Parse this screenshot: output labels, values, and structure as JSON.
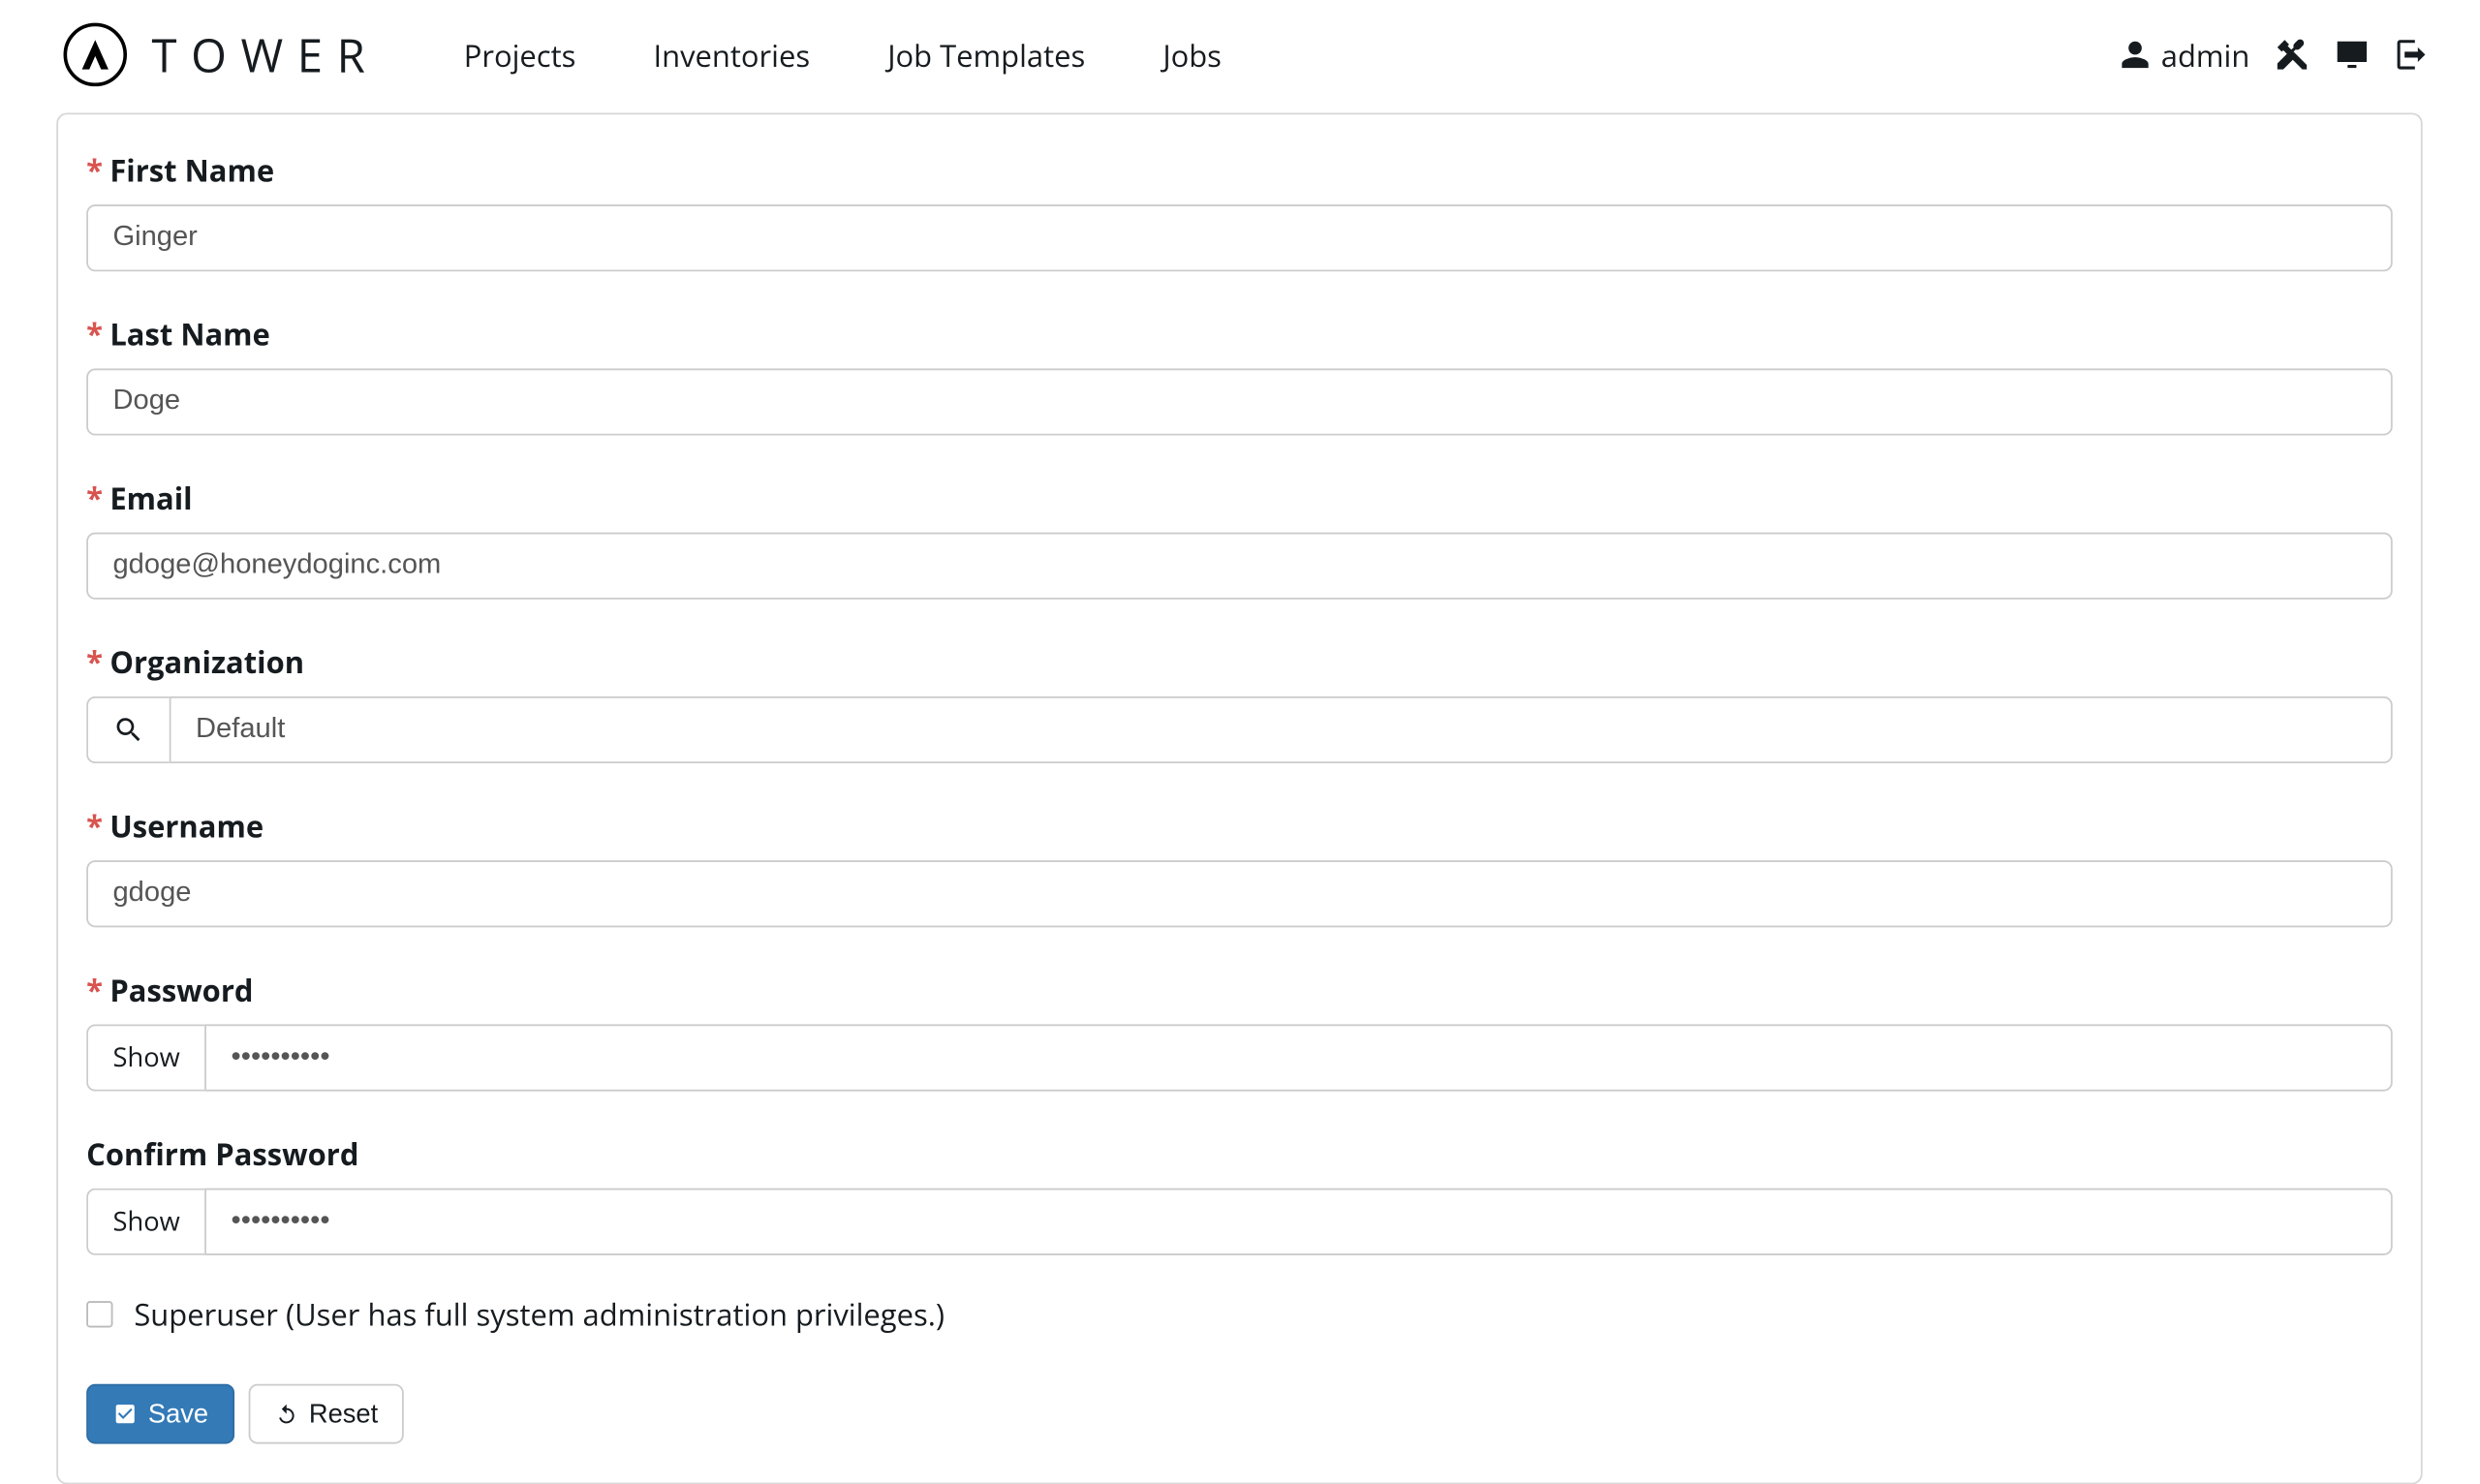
{
  "brand": {
    "text": "TOWER"
  },
  "nav": {
    "projects": "Projects",
    "inventories": "Inventories",
    "job_templates": "Job Templates",
    "jobs": "Jobs"
  },
  "user": {
    "name": "admin"
  },
  "form": {
    "first_name": {
      "label": "First Name",
      "value": "Ginger",
      "required": true
    },
    "last_name": {
      "label": "Last Name",
      "value": "Doge",
      "required": true
    },
    "email": {
      "label": "Email",
      "value": "gdoge@honeydoginc.com",
      "required": true
    },
    "organization": {
      "label": "Organization",
      "value": "Default",
      "required": true
    },
    "username": {
      "label": "Username",
      "value": "gdoge",
      "required": true
    },
    "password": {
      "label": "Password",
      "value": "••••••••••",
      "show_label": "Show",
      "required": true
    },
    "confirm": {
      "label": "Confirm Password",
      "value": "••••••••••",
      "show_label": "Show",
      "required": false
    },
    "superuser": {
      "label": "Superuser (User has full system administration privileges.)",
      "checked": false
    }
  },
  "buttons": {
    "save": "Save",
    "reset": "Reset"
  }
}
